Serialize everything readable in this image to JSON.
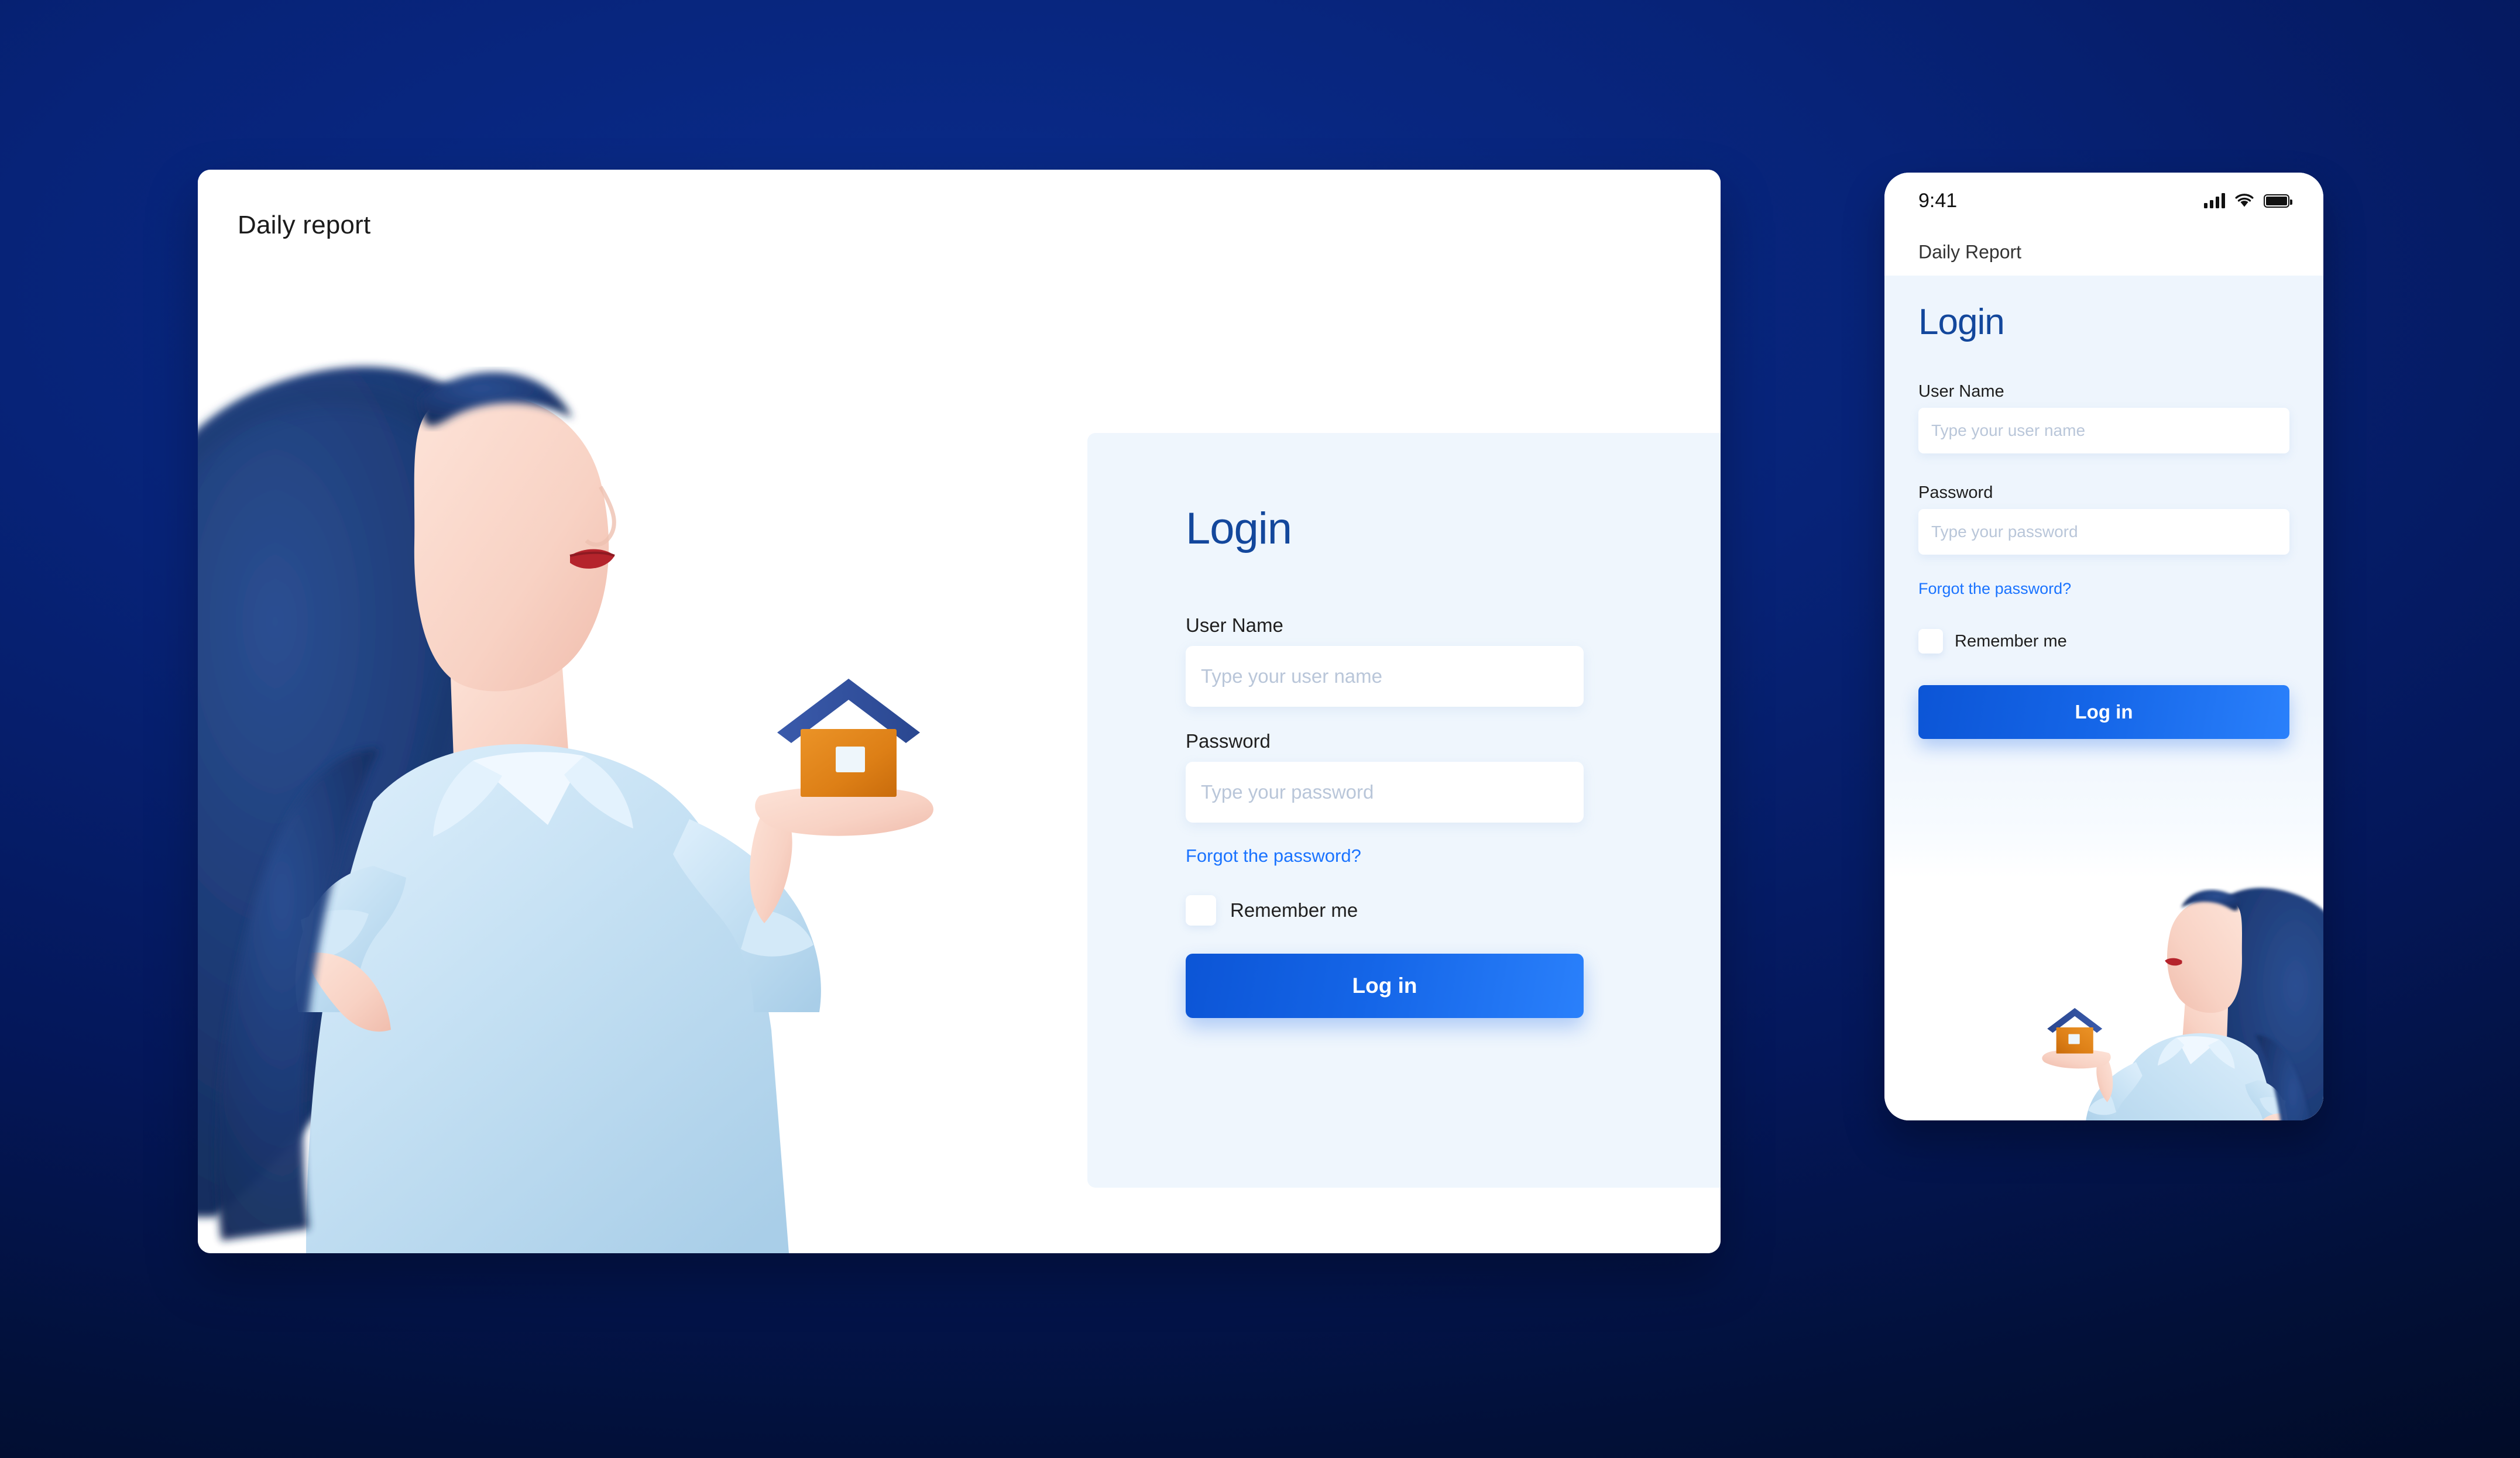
{
  "theme": {
    "background_navy": "#072378",
    "background_navy_dark": "#021038",
    "accent_blue": "#1566e8",
    "link_blue": "#1a73ff",
    "title_blue": "#13479c",
    "panel_bg": "#eff6fd",
    "card_bg": "#ffffff",
    "placeholder_grey": "#b9c6d9",
    "illustration_hair": "#1d3a75",
    "illustration_shirt": "#bfdcf0",
    "illustration_skin": "#fbdcd0",
    "illustration_house_body": "#e0821a",
    "illustration_house_roof": "#2f4f9e"
  },
  "desktop": {
    "header": {
      "title": "Daily report"
    },
    "illustration": {
      "name": "woman-holding-house-illustration",
      "description": "Woman with long dark navy hair in a light blue shirt holding a small orange house with a navy roof in her palm"
    },
    "login": {
      "heading": "Login",
      "username": {
        "label": "User Name",
        "placeholder": "Type your user name",
        "value": ""
      },
      "password": {
        "label": "Password",
        "placeholder": "Type your password",
        "value": ""
      },
      "forgot_link": "Forgot the password?",
      "remember": {
        "label": "Remember me",
        "checked": false
      },
      "submit": "Log in"
    }
  },
  "mobile": {
    "status_bar": {
      "time": "9:41",
      "icons": [
        "cellular-signal-icon",
        "wifi-icon",
        "battery-icon"
      ]
    },
    "header": {
      "title": "Daily Report"
    },
    "login": {
      "heading": "Login",
      "username": {
        "label": "User Name",
        "placeholder": "Type your user name",
        "value": ""
      },
      "password": {
        "label": "Password",
        "placeholder": "Type your password",
        "value": ""
      },
      "forgot_link": "Forgot the password?",
      "remember": {
        "label": "Remember me",
        "checked": false
      },
      "submit": "Log in"
    },
    "illustration": {
      "name": "woman-holding-house-illustration-mirrored",
      "description": "Mirrored illustration of the woman with navy hair holding an orange house"
    }
  }
}
